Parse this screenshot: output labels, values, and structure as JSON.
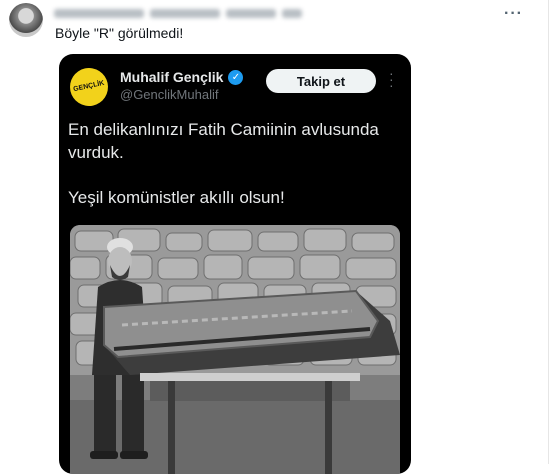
{
  "outer_tweet": {
    "reply_text": "Böyle \"R\" görülmedi!",
    "more_icon": "more-horizontal-icon"
  },
  "quoted_tweet": {
    "author_name": "Muhalif Gençlik",
    "author_handle": "@GenclikMuhalif",
    "logo_text": "GENÇLİK",
    "follow_label": "Takip et",
    "body_lines": [
      "En delikanlınızı Fatih Camiinin avlusunda vurduk.",
      "Yeşil komünistler akıllı olsun!"
    ],
    "colors": {
      "background": "#000000",
      "verified": "#1d9bf0",
      "logo_bg": "#f2d21b"
    }
  }
}
